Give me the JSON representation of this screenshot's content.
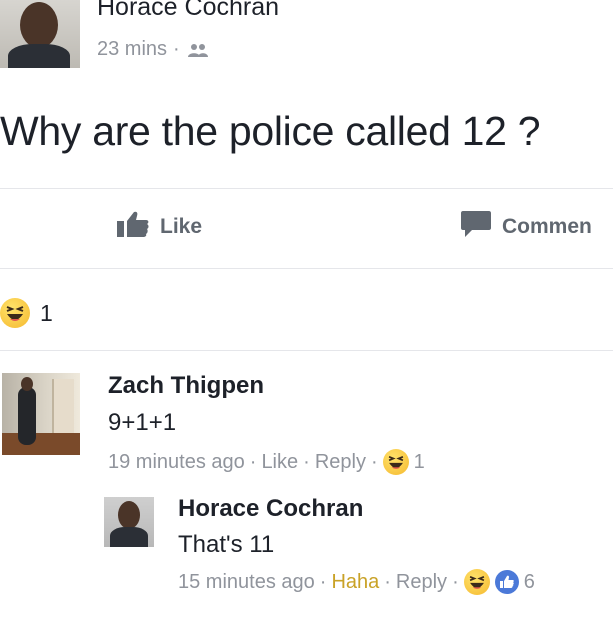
{
  "post": {
    "author": "Horace Cochran",
    "time": "23 mins",
    "separator": "·",
    "audience_icon": "friends-icon",
    "text": "Why are the police called 12 ?"
  },
  "actions": {
    "like_label": "Like",
    "like_icon": "thumbs-up-icon",
    "comment_label": "Commen",
    "comment_icon": "speech-bubble-icon"
  },
  "reactions": {
    "icon": "haha-emoji-icon",
    "count": "1"
  },
  "comments": [
    {
      "author": "Zach Thigpen",
      "text": "9+1+1",
      "time": "19 minutes ago",
      "sep1": "·",
      "action1": "Like",
      "sep2": "·",
      "action2": "Reply",
      "sep3": "·",
      "reaction_count": "1"
    },
    {
      "author": "Horace Cochran",
      "text": "That's 11",
      "time": "15 minutes ago",
      "sep1": "·",
      "action1": "Haha",
      "sep2": "·",
      "action2": "Reply",
      "sep3": "·",
      "reaction_count": "6"
    }
  ],
  "colors": {
    "text": "#1d2129",
    "meta": "#90949c",
    "haha_active": "#c9a227",
    "like_blue": "#4b79d8",
    "divider": "#e5e6ea"
  }
}
